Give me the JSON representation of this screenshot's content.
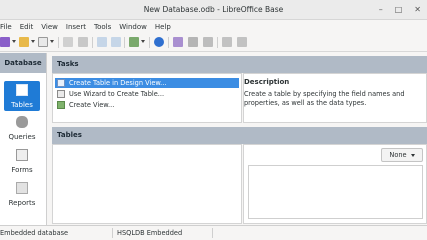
{
  "window": {
    "title": "New Database.odb - LibreOffice Base",
    "controls": {
      "minimize": "–",
      "maximize": "□",
      "close": "✕"
    }
  },
  "menu": [
    "File",
    "Edit",
    "View",
    "Insert",
    "Tools",
    "Window",
    "Help"
  ],
  "sidebar": {
    "header": "Database",
    "items": [
      {
        "label": "Tables",
        "icon": "tables-icon",
        "active": true
      },
      {
        "label": "Queries",
        "icon": "queries-icon",
        "active": false
      },
      {
        "label": "Forms",
        "icon": "forms-icon",
        "active": false
      },
      {
        "label": "Reports",
        "icon": "reports-icon",
        "active": false
      }
    ]
  },
  "tasks": {
    "header": "Tasks",
    "items": [
      {
        "label": "Create Table in Design View...",
        "selected": true
      },
      {
        "label": "Use Wizard to Create Table...",
        "selected": false
      },
      {
        "label": "Create View...",
        "selected": false
      }
    ],
    "description_title": "Description",
    "description_text": "Create a table by specifying the field names and properties, as well as the data types."
  },
  "tables": {
    "header": "Tables",
    "preview_select": "None"
  },
  "status": {
    "left": "Embedded database",
    "middle": "HSQLDB Embedded"
  },
  "colors": {
    "accent": "#1f7bd6",
    "selection": "#3c8de3",
    "panel_header": "#b0bac6"
  }
}
